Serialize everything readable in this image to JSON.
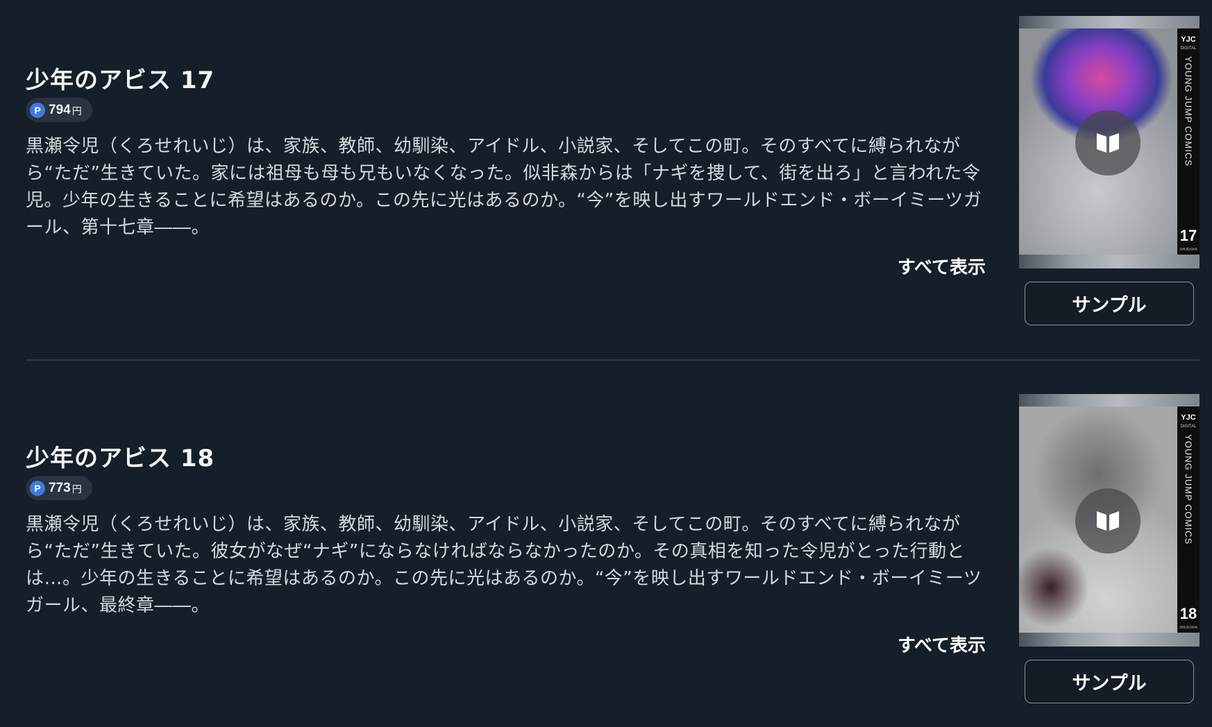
{
  "items": [
    {
      "title": "少年のアビス 17",
      "price": {
        "point_badge": "P",
        "amount": "794",
        "unit": "円"
      },
      "description": "黒瀬令児（くろせれいじ）は、家族、教師、幼馴染、アイドル、小説家、そしてこの町。そのすべてに縛られながら“ただ”生きていた。家には祖母も母も兄もいなくなった。似非森からは「ナギを捜して、街を出ろ」と言われた令児。少年の生きることに希望はあるのか。この先に光はあるのか。“今”を映し出すワールドエンド・ボーイミーツガール、第十七章――。",
      "show_all_label": "すべて表示",
      "sample_label": "サンプル",
      "cover": {
        "badge": "YJC",
        "badge_sub": "DIGITAL",
        "spine_text": "YOUNG JUMP COMICS",
        "volume": "17",
        "publisher": "SHUEISHA"
      }
    },
    {
      "title": "少年のアビス 18",
      "price": {
        "point_badge": "P",
        "amount": "773",
        "unit": "円"
      },
      "description": "黒瀬令児（くろせれいじ）は、家族、教師、幼馴染、アイドル、小説家、そしてこの町。そのすべてに縛られながら“ただ”生きていた。彼女がなぜ“ナギ”にならなければならなかったのか。その真相を知った令児がとった行動とは…。少年の生きることに希望はあるのか。この先に光はあるのか。“今”を映し出すワールドエンド・ボーイミーツガール、最終章――。",
      "show_all_label": "すべて表示",
      "sample_label": "サンプル",
      "cover": {
        "badge": "YJC",
        "badge_sub": "DIGITAL",
        "spine_text": "YOUNG JUMP COMICS",
        "volume": "18",
        "publisher": "SHUEISHA"
      }
    }
  ],
  "icons": {
    "point": "point-icon",
    "open_book": "open-book-icon"
  },
  "colors": {
    "background": "#161e29",
    "point_badge": "#3d7be0",
    "price_pill": "#2a333f",
    "divider": "#2f3844",
    "button_border": "#8b929c"
  }
}
